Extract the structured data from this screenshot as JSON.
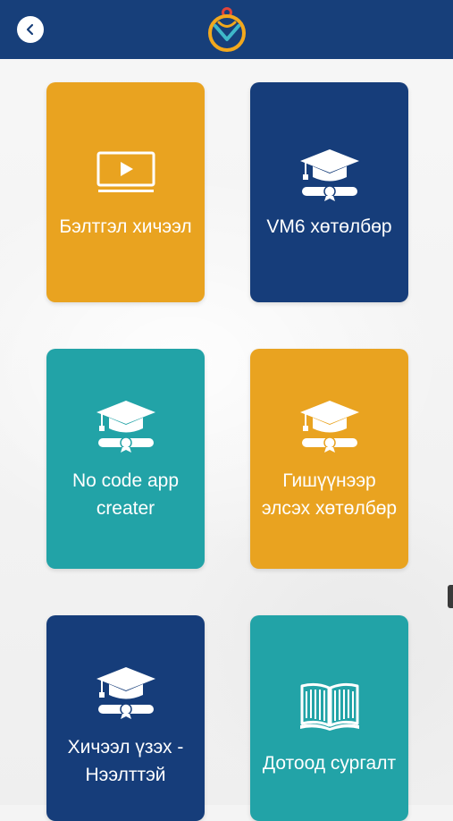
{
  "header": {
    "back_icon": "chevron-left-icon",
    "logo_icon": "app-logo"
  },
  "cards": [
    {
      "label": "Бэлтгэл хичээл",
      "icon": "tv-play-icon",
      "color": "#e9a320"
    },
    {
      "label": "VM6 хөтөлбөр",
      "icon": "graduation-cap-icon",
      "color": "#163d7a"
    },
    {
      "label": "No code app creater",
      "icon": "graduation-cap-icon",
      "color": "#22a3a7"
    },
    {
      "label": "Гишүүнээр элсэх хөтөлбөр",
      "icon": "graduation-cap-icon",
      "color": "#e9a320"
    },
    {
      "label": "Хичээл үзэх - Нээлттэй",
      "icon": "graduation-cap-icon",
      "color": "#163d7a"
    },
    {
      "label": "Дотоод сургалт",
      "icon": "open-book-icon",
      "color": "#22a3a7"
    }
  ],
  "colors": {
    "header_bg": "#173f7a",
    "orange": "#e9a320",
    "navy": "#163d7a",
    "teal": "#22a3a7"
  }
}
